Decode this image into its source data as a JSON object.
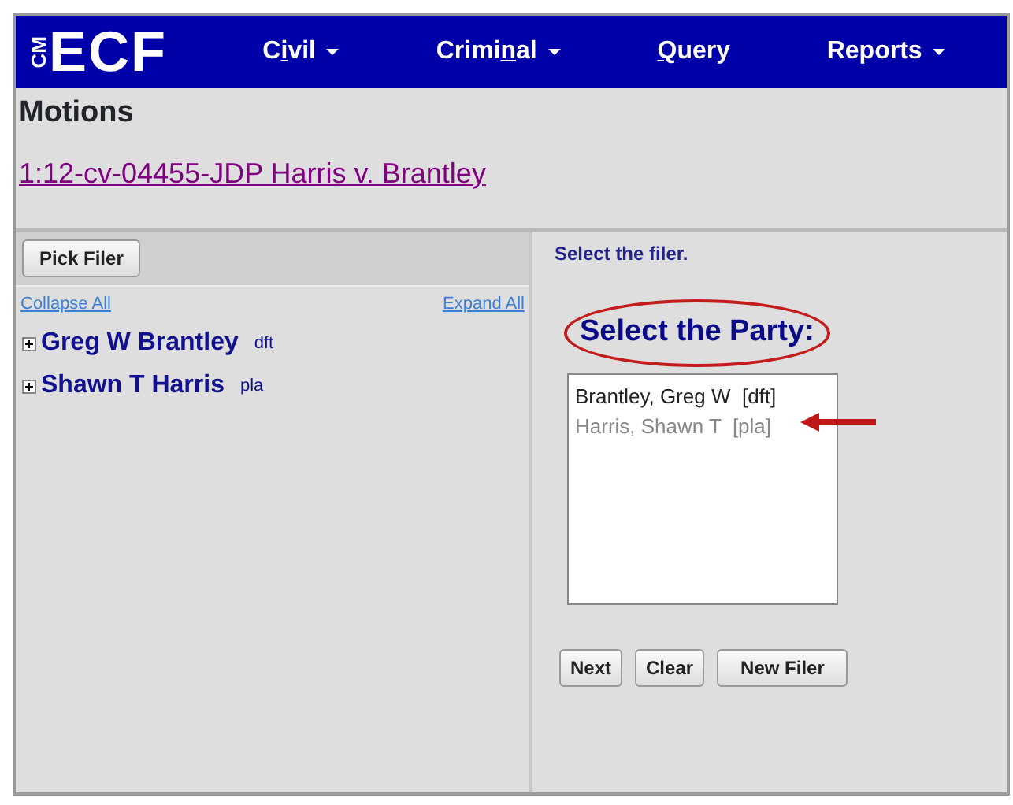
{
  "logo": {
    "small": "CM",
    "big": "ECF"
  },
  "menu": [
    {
      "before": "C",
      "key": "i",
      "after": "vil",
      "dropdown": true
    },
    {
      "before": "Crimi",
      "key": "n",
      "after": "al",
      "dropdown": true
    },
    {
      "key": "Q",
      "after": "uery",
      "dropdown": false
    },
    {
      "before": "Reports",
      "dropdown": true
    }
  ],
  "page_title": "Motions",
  "case_link": "1:12-cv-04455-JDP Harris v. Brantley",
  "left_panel": {
    "button": "Pick Filer",
    "collapse_all": "Collapse All",
    "expand_all": "Expand All",
    "tree": [
      {
        "name": "Greg W Brantley",
        "role": "dft",
        "expanded": false
      },
      {
        "name": "Shawn T Harris",
        "role": "pla",
        "expanded": false
      }
    ]
  },
  "right_panel": {
    "instruction": "Select the filer.",
    "heading": "Select the Party:",
    "options": [
      {
        "label": "Brantley, Greg W  [dft]",
        "disabled": false
      },
      {
        "label": "Harris, Shawn T  [pla]",
        "disabled": true
      }
    ],
    "buttons": [
      "Next",
      "Clear",
      "New Filer"
    ]
  }
}
